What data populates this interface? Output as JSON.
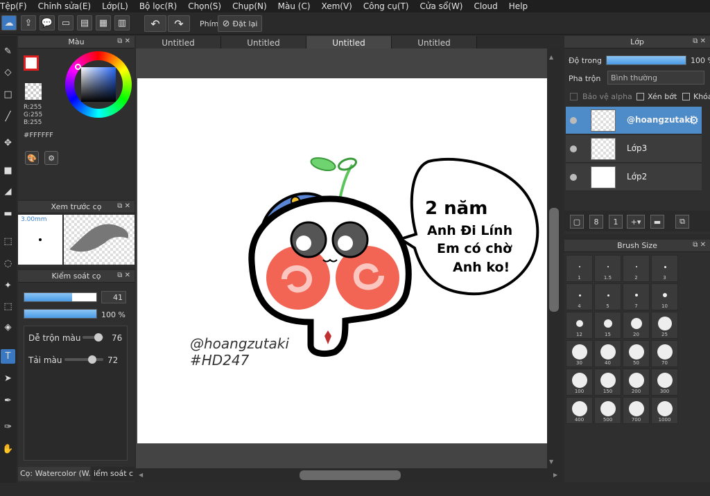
{
  "menu": [
    "Tệp(F)",
    "Chỉnh sửa(E)",
    "Lớp(L)",
    "Bộ lọc(R)",
    "Chọn(S)",
    "Chụp(N)",
    "Màu (C)",
    "Xem(V)",
    "Công cụ(T)",
    "Cửa sổ(W)",
    "Cloud",
    "Help"
  ],
  "toolbar": {
    "shortcut_label": "Phím",
    "reset_label": "Đặt lại"
  },
  "tabs": [
    "Untitled",
    "Untitled",
    "Untitled",
    "Untitled"
  ],
  "color_panel": {
    "title": "Màu",
    "rgb_r": "R:255",
    "rgb_g": "G:255",
    "rgb_b": "B:255",
    "hex": "#FFFFFF"
  },
  "brush_preview": {
    "title": "Xem trước cọ",
    "size": "3.00mm"
  },
  "brush_control": {
    "title": "Kiểm soát cọ",
    "size_value": "41",
    "opacity_value": "100 %",
    "blend_label": "Dễ trộn màu",
    "blend_value": "76",
    "dilution_label": "Tải màu",
    "dilution_value": "72",
    "size_fraction": 0.66,
    "opacity_fraction": 1.0,
    "blend_fraction": 0.76,
    "dilution_fraction": 0.72,
    "tab1": "Cọ: Watercolor (W...",
    "tab2": "iểm soát c"
  },
  "layer_panel": {
    "title": "Lớp",
    "opacity_label": "Độ trong",
    "opacity_value": "100 %",
    "blend_label": "Pha trộn",
    "blend_value": "Bình thường",
    "protect_alpha": "Bảo vệ alpha",
    "clipping": "Xén bớt",
    "lock": "Khóa",
    "layers": [
      {
        "name": "@hoangzutaki"
      },
      {
        "name": "Lớp3"
      },
      {
        "name": "Lớp2"
      }
    ]
  },
  "brush_size": {
    "title": "Brush Size",
    "sizes": [
      "1",
      "1.5",
      "2",
      "3",
      "4",
      "5",
      "7",
      "10",
      "12",
      "15",
      "20",
      "25",
      "30",
      "40",
      "50",
      "70",
      "100",
      "150",
      "200",
      "300",
      "400",
      "500",
      "700",
      "1000"
    ]
  },
  "artwork": {
    "speech": [
      "2 năm",
      "Anh Đi Lính",
      "Em có chờ",
      "Anh ko!"
    ],
    "watermark1": "@hoangzutaki",
    "watermark2": "#HD247"
  }
}
